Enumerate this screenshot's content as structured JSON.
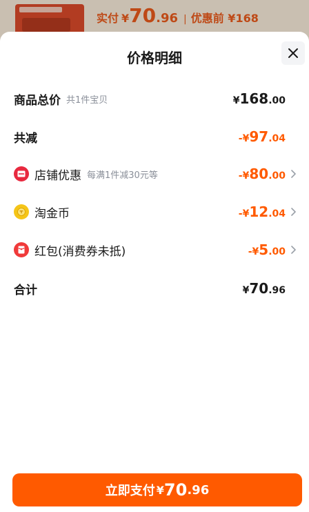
{
  "background_header": {
    "pay_label": "实付",
    "currency": "¥",
    "pay_int": "70",
    "pay_dec": ".96",
    "separator": "|",
    "original_label": "优惠前 ¥168"
  },
  "sheet": {
    "title": "价格明细",
    "close_icon": "close-icon"
  },
  "rows": {
    "total": {
      "name": "商品总价",
      "sub": "共1件宝贝",
      "currency": "¥",
      "int": "168",
      "dec": ".00"
    },
    "reduced": {
      "name": "共减",
      "currency": "-¥",
      "int": "97",
      "dec": ".04"
    },
    "shop": {
      "icon": "shop-coupon-icon",
      "name": "店铺优惠",
      "sub": "每满1件减30元等",
      "currency": "-¥",
      "int": "80",
      "dec": ".00"
    },
    "coin": {
      "icon": "gold-coin-icon",
      "name": "淘金币",
      "currency": "-¥",
      "int": "12",
      "dec": ".04"
    },
    "redpacket": {
      "icon": "red-packet-icon",
      "name": "红包(消费券未抵)",
      "currency": "-¥",
      "int": "5",
      "dec": ".00"
    },
    "sum": {
      "name": "合计",
      "currency": "¥",
      "int": "70",
      "dec": ".96"
    }
  },
  "pay_button": {
    "label": "立即支付",
    "currency": "¥",
    "int": "70",
    "dec": ".96"
  },
  "colors": {
    "accent": "#ff5a00",
    "shop_icon": "#e8293f",
    "coin_icon": "#f5c518",
    "redpacket_icon": "#f03a3a"
  }
}
